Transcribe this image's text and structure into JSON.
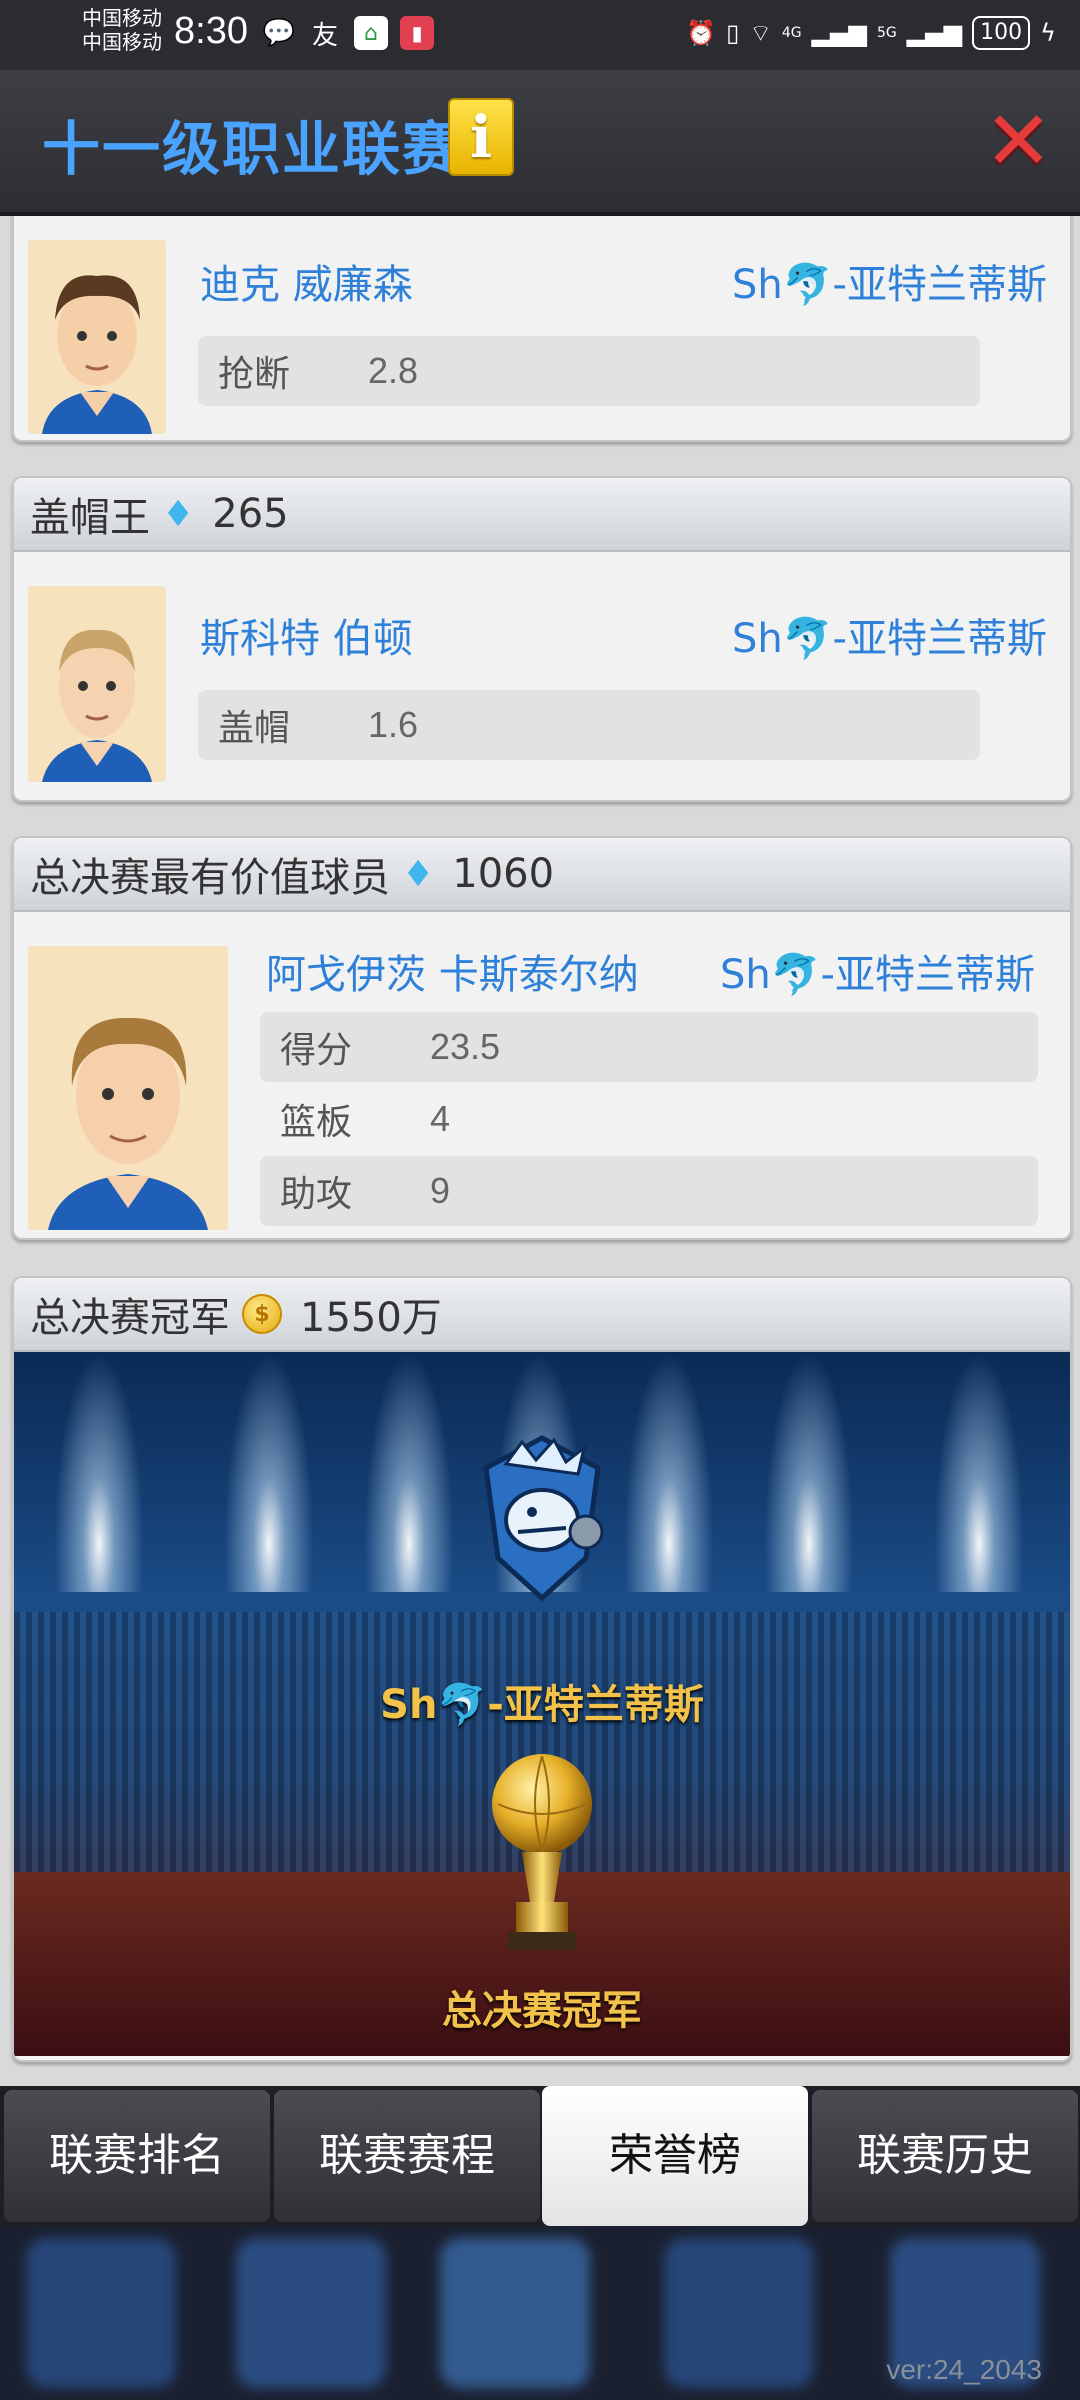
{
  "status": {
    "carrier_line1": "中国移动",
    "carrier_line2": "中国移动",
    "time": "8:30",
    "net1": "4G",
    "net2": "5G",
    "battery": "100"
  },
  "header": {
    "title": "十一级职业联赛",
    "info_label": "i",
    "close_glyph": "✕"
  },
  "steals_card": {
    "player": "迪克 威廉森",
    "team": "Sh🐬-亚特兰蒂斯",
    "stat_label": "抢断",
    "stat_value": "2.8"
  },
  "blocks_card": {
    "title": "盖帽王",
    "reward": "265",
    "player": "斯科特 伯顿",
    "team": "Sh🐬-亚特兰蒂斯",
    "stat_label": "盖帽",
    "stat_value": "1.6"
  },
  "mvp_card": {
    "title": "总决赛最有价值球员",
    "reward": "1060",
    "player": "阿戈伊茨 卡斯泰尔纳",
    "team": "Sh🐬-亚特兰蒂斯",
    "stats": [
      {
        "label": "得分",
        "value": "23.5"
      },
      {
        "label": "篮板",
        "value": "4"
      },
      {
        "label": "助攻",
        "value": "9"
      }
    ]
  },
  "champion_card": {
    "title": "总决赛冠军",
    "reward": "1550万",
    "team": "Sh🐬-亚特兰蒂斯",
    "trophy_label": "总决赛冠军"
  },
  "tabs": [
    {
      "label": "联赛排名"
    },
    {
      "label": "联赛赛程"
    },
    {
      "label": "荣誉榜",
      "active": true
    },
    {
      "label": "联赛历史"
    }
  ],
  "footer": {
    "version": "ver:24_2043"
  },
  "colors": {
    "accent_blue": "#2f80d8",
    "title_blue": "#4aa3ff",
    "gold": "#f2c24a",
    "close_red": "#e53b3b"
  }
}
